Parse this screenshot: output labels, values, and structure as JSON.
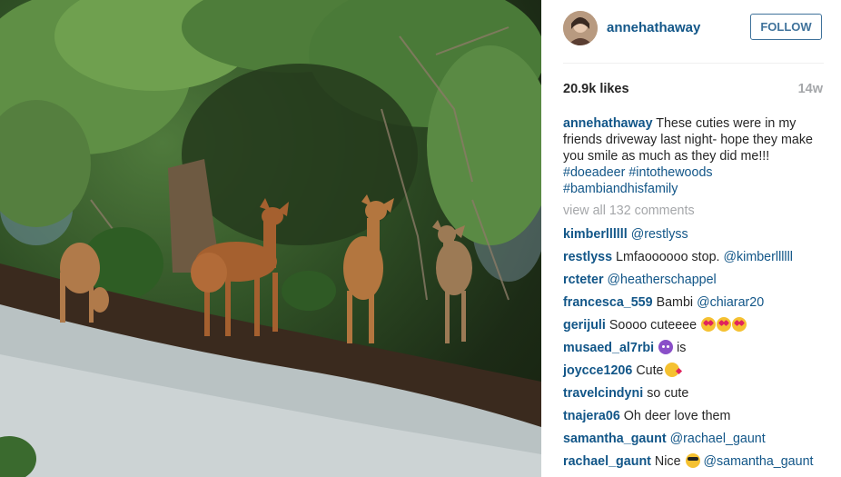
{
  "post": {
    "username": "annehathaway",
    "follow_label": "FOLLOW",
    "likes": "20.9k likes",
    "age": "14w",
    "caption": {
      "username": "annehathaway",
      "text": " These cuties were in my friends driveway last night- hope they make you smile as much as they did me!!!",
      "hashtags": [
        "#doeadeer",
        "#intothewoods",
        "#bambiandhisfamily"
      ]
    },
    "view_all": "view all 132 comments"
  },
  "comments": [
    {
      "user": "kimberllllll",
      "parts": [
        {
          "t": "mention",
          "v": "@restlyss"
        }
      ]
    },
    {
      "user": "restlyss",
      "parts": [
        {
          "t": "text",
          "v": "Lmfaoooooo stop. "
        },
        {
          "t": "mention",
          "v": "@kimberllllll"
        }
      ]
    },
    {
      "user": "rcteter",
      "parts": [
        {
          "t": "mention",
          "v": "@heatherschappel"
        }
      ]
    },
    {
      "user": "francesca_559",
      "parts": [
        {
          "t": "text",
          "v": "Bambi "
        },
        {
          "t": "mention",
          "v": "@chiarar20"
        }
      ]
    },
    {
      "user": "gerijuli",
      "parts": [
        {
          "t": "text",
          "v": "Soooo cuteeee "
        },
        {
          "t": "emoji",
          "v": "heart-eyes"
        },
        {
          "t": "emoji",
          "v": "heart-eyes"
        },
        {
          "t": "emoji",
          "v": "heart-eyes"
        }
      ]
    },
    {
      "user": "musaed_al7rbi",
      "parts": [
        {
          "t": "emoji",
          "v": "devil"
        },
        {
          "t": "text",
          "v": " is"
        }
      ]
    },
    {
      "user": "joycce1206",
      "parts": [
        {
          "t": "text",
          "v": "Cute"
        },
        {
          "t": "emoji",
          "v": "kiss"
        }
      ]
    },
    {
      "user": "travelcindyni",
      "parts": [
        {
          "t": "text",
          "v": "so cute"
        }
      ]
    },
    {
      "user": "tnajera06",
      "parts": [
        {
          "t": "text",
          "v": "Oh deer love them"
        }
      ]
    },
    {
      "user": "samantha_gaunt",
      "parts": [
        {
          "t": "mention",
          "v": "@rachael_gaunt"
        }
      ]
    },
    {
      "user": "rachael_gaunt",
      "parts": [
        {
          "t": "text",
          "v": "Nice "
        },
        {
          "t": "emoji",
          "v": "sunglasses"
        },
        {
          "t": "text",
          "v": " "
        },
        {
          "t": "mention",
          "v": "@samantha_gaunt"
        }
      ]
    }
  ],
  "colors": {
    "link": "#125688",
    "follow_border": "#3f729b",
    "muted": "#a5a7aa",
    "text": "#262626"
  },
  "icons": [
    "avatar-photo",
    "heart-eyes-emoji",
    "devil-emoji",
    "kiss-emoji",
    "sunglasses-emoji"
  ]
}
